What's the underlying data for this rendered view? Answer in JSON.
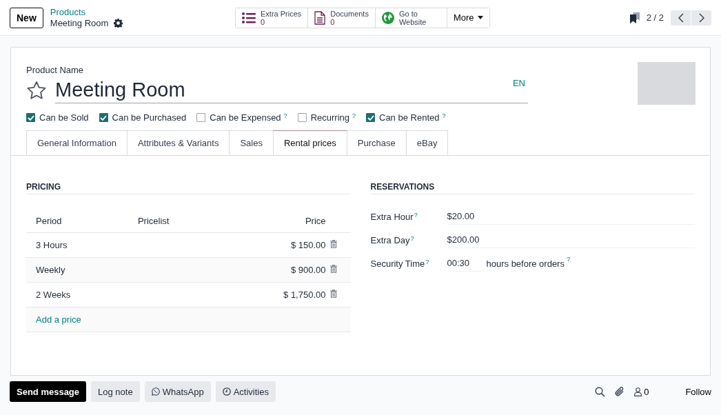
{
  "control_panel": {
    "new_button": "New",
    "breadcrumb": {
      "parent": "Products",
      "current": "Meeting Room"
    },
    "smart_buttons": [
      {
        "kind": "list",
        "label": "Extra Prices",
        "count": "0"
      },
      {
        "kind": "document",
        "label": "Documents",
        "count": "0"
      },
      {
        "kind": "globe",
        "label": "Go to Website"
      }
    ],
    "more_button": "More",
    "pager": "2 / 2"
  },
  "form": {
    "name_label": "Product Name",
    "name": "Meeting Room",
    "favorite": false,
    "language": "EN",
    "checkboxes": [
      {
        "label": "Can be Sold",
        "checked": true
      },
      {
        "label": "Can be Purchased",
        "checked": true
      },
      {
        "label": "Can be Expensed",
        "checked": false,
        "hint": "?"
      },
      {
        "label": "Recurring",
        "checked": false,
        "hint": "?"
      },
      {
        "label": "Can be Rented",
        "checked": true,
        "hint": "?"
      }
    ],
    "tabs": [
      {
        "label": "General Information",
        "selected": false
      },
      {
        "label": "Attributes & Variants",
        "selected": false
      },
      {
        "label": "Sales",
        "selected": false
      },
      {
        "label": "Rental prices",
        "selected": true
      },
      {
        "label": "Purchase",
        "selected": false
      },
      {
        "label": "eBay",
        "selected": false
      }
    ],
    "pricing": {
      "title": "PRICING",
      "columns": [
        "Period",
        "Pricelist",
        "Price"
      ],
      "rows": [
        {
          "period": "3 Hours",
          "price": "$ 150.00"
        },
        {
          "period": "Weekly",
          "price": "$ 900.00"
        },
        {
          "period": "2 Weeks",
          "price": "$ 1,750.00"
        }
      ],
      "add_link": "Add a price"
    },
    "reservations": {
      "title": "RESERVATIONS",
      "fields": [
        {
          "label": "Extra Hour",
          "hint": "?",
          "value": "$20.00"
        },
        {
          "label": "Extra Day",
          "hint": "?",
          "value": "$200.00"
        },
        {
          "label": "Security Time",
          "hint": "?",
          "value": "00:30",
          "suffix": "hours before orders",
          "suffix_hint": "?"
        }
      ]
    }
  },
  "chatter": {
    "buttons": [
      {
        "kind": "primary",
        "label": "Send message"
      },
      {
        "kind": "plain",
        "label": "Log note"
      },
      {
        "kind": "whatsapp",
        "label": "WhatsApp"
      },
      {
        "kind": "activities",
        "label": "Activities"
      }
    ],
    "followers": "0",
    "follow": "Follow"
  }
}
